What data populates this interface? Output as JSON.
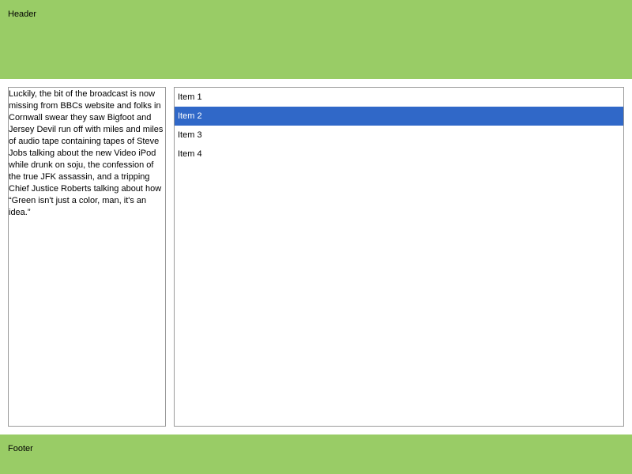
{
  "colors": {
    "bar_background": "#99cc66",
    "selection_background": "#3068c8",
    "selection_text": "#ffffff"
  },
  "header": {
    "label": "Header"
  },
  "footer": {
    "label": "Footer"
  },
  "left_panel": {
    "text": "Luckily, the bit of the broadcast is now missing from BBCs website and folks in Cornwall swear they saw Bigfoot and Jersey Devil run off with miles and miles of audio tape containing tapes of Steve Jobs talking about the new Video iPod while drunk on soju, the confession of the true JFK assassin, and a tripping Chief Justice Roberts talking about how “Green isn't just a color, man, it's an idea.”"
  },
  "list": {
    "selected_index": 1,
    "items": [
      {
        "label": "Item 1"
      },
      {
        "label": "Item 2"
      },
      {
        "label": "Item 3"
      },
      {
        "label": "Item 4"
      }
    ]
  }
}
